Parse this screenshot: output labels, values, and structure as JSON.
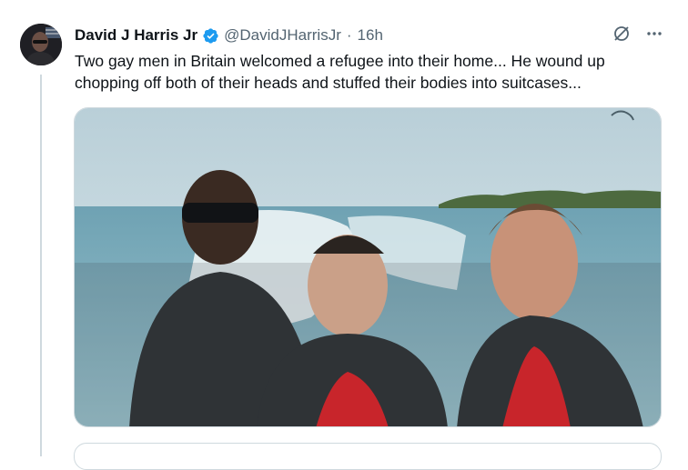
{
  "tweet": {
    "display_name": "David J Harris Jr",
    "handle": "@DavidJHarrisJr",
    "separator": "·",
    "time": "16h",
    "text": "Two gay men in Britain welcomed a refugee into their home... He wound up chopping off both of their heads and stuffed their bodies into suitcases...",
    "verified_color": "#1d9bf0",
    "icons": {
      "avatar": "avatar-photo",
      "verified": "verified-badge-icon",
      "grok": "grok-icon",
      "more": "more-icon"
    },
    "media": {
      "kind": "photo",
      "colors": {
        "sky": "#c9dde3",
        "sea": "#8fb9c6",
        "wake": "#f2f7f8",
        "vest": "#2f3336",
        "red_shirt": "#c8252b"
      }
    }
  }
}
